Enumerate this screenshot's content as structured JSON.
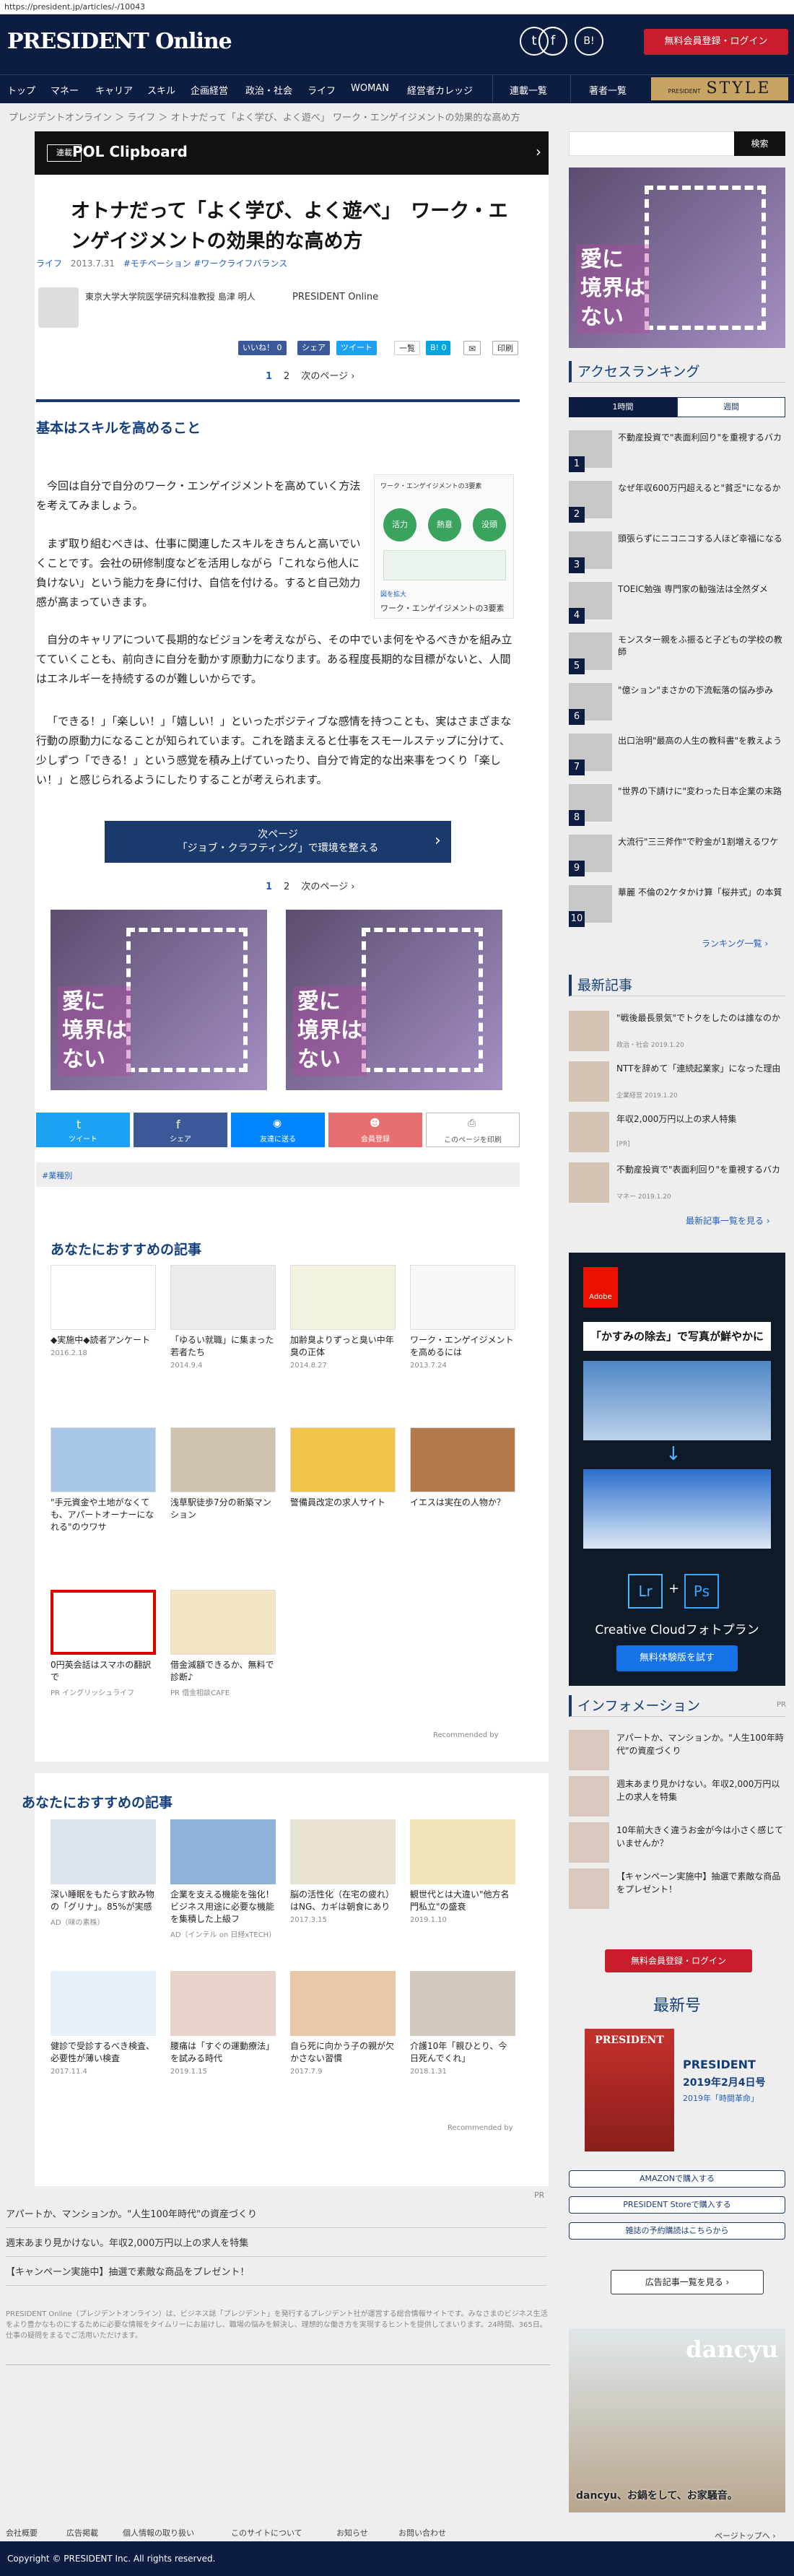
{
  "url": "https://president.jp/articles/-/10043",
  "brand": {
    "logo": "PRESIDENT Online",
    "register": "無料会員登録・ログイン",
    "style_logo": "STYLE",
    "style_prefix": "PRESIDENT"
  },
  "social": {
    "twitter": "t",
    "facebook": "f",
    "hatena": "B!"
  },
  "nav": [
    "トップ",
    "マネー",
    "キャリア",
    "スキル",
    "企画経営",
    "政治・社会",
    "ライフ",
    "WOMAN",
    "経営者カレッジ",
    "連載一覧",
    "著者一覧"
  ],
  "breadcrumb": "プレジデントオンライン ＞ ライフ ＞ オトナだって「よく学び、よく遊べ」 ワーク・エンゲイジメントの効果的な高め方",
  "series": {
    "badge": "連載",
    "title": "POL Clipboard"
  },
  "article": {
    "title": "オトナだって「よく学び、よく遊べ」　ワーク・エンゲイジメントの効果的な高め方",
    "category": "ライフ",
    "date": "2013.7.31",
    "tags": "#モチベーション  #ワークライフバランス",
    "author": "東京大学大学院医学研究科准教授 島津 明人",
    "source": "PRESIDENT Online",
    "share": {
      "like": "いいね！ 0",
      "share": "シェア",
      "tweet": "ツイート",
      "plusone": "一覧",
      "bookmark": "B! 0",
      "print": "印刷"
    },
    "pager": {
      "p1": "1",
      "p2": "2",
      "next": "次のページ ›"
    },
    "section_title": "基本はスキルを高めること",
    "p1": "今回は自分で自分のワーク・エンゲイジメントを高めていく方法を考えてみましょう。",
    "p2": "まず取り組むべきは、仕事に関連したスキルをきちんと高いでいくことです。会社の研修制度などを活用しながら「これなら他人に負けない」という能力を身に付け、自信を付ける。すると自己効力感が高まっていきます。",
    "p3": "自分のキャリアについて長期的なビジョンを考えながら、その中でいま何をやるべきかを組み立てていくことも、前向きに自分を動かす原動力になります。ある程度長期的な目標がないと、人間はエネルギーを持続するのが難しいからです。",
    "p4": "「できる！」「楽しい！」「嬉しい！」といったポジティブな感情を持つことも、実はさまざまな行動の原動力になることが知られています。これを踏まえると仕事をスモールステップに分けて、少しずつ「できる！」という感覚を積み上げていったり、自分で肯定的な出来事をつくり「楽しい！」と感じられるようにしたりすることが考えられます。",
    "figure_title": "ワーク・エンゲイジメントの3要素",
    "figure_caption": "ワーク・エンゲイジメントの3要素",
    "figure_source": "図を拡大",
    "figure_items": [
      "活力",
      "熱意",
      "没頭"
    ],
    "next_btn_1": "次ページ",
    "next_btn_2": "「ジョブ・クラフティング」で環境を整える"
  },
  "ad_text": "愛に\n境界は\nない",
  "share_big": [
    "ツイート",
    "シェア",
    "友達に送る",
    "会員登録",
    "このページを印刷"
  ],
  "tag": "#業種別",
  "rec1": {
    "title": "あなたにおすすめの記事",
    "items": [
      {
        "title": "◆実施中◆読者アンケート",
        "date": "2016.2.18"
      },
      {
        "title": "「ゆるい就職」に集まった若者たち",
        "date": "2014.9.4"
      },
      {
        "title": "加齢臭よりずっと臭い中年臭の正体",
        "date": "2014.8.27"
      },
      {
        "title": "ワーク・エンゲイジメントを高めるには",
        "date": "2013.7.24"
      },
      {
        "title": "\"手元資金や土地がなくても、アパートオーナーになれる\"のウワサ",
        "date": ""
      },
      {
        "title": "浅草駅徒歩7分の新築マンション",
        "date": ""
      },
      {
        "title": "警備員改定の求人サイト",
        "date": ""
      },
      {
        "title": "イエスは実在の人物か？",
        "date": ""
      },
      {
        "title": "0円英会話はスマホの翻訳で",
        "date": "PR イングリッシュライフ"
      },
      {
        "title": "借金減額できるか、無料で診断♪",
        "date": "PR 借金相談CAFE"
      }
    ],
    "recommended": "Recommended by"
  },
  "rec2": {
    "title": "あなたにおすすめの記事",
    "items": [
      {
        "title": "深い睡眠をもたらす飲み物の「グリナ」。85%が実感",
        "date": "AD（味の素株）"
      },
      {
        "title": "企業を支える機能を強化！ビジネス用途に必要な機能を集積した上級フ",
        "date": "AD（インテル on 日経xTECH）"
      },
      {
        "title": "脳の活性化（在宅の疲れ）はNG、カギは朝食にあり",
        "date": "2017.3.15"
      },
      {
        "title": "観世代とは大違い\"他方名門私立\"の盛衰",
        "date": "2019.1.10"
      },
      {
        "title": "健診で受診するべき検査、必要性が薄い検査",
        "date": "2017.11.4"
      },
      {
        "title": "腰痛は「すぐの運動療法」を試みる時代",
        "date": "2019.1.15"
      },
      {
        "title": "自ら死に向かう子の親が欠かさない習慣",
        "date": "2017.7.9"
      },
      {
        "title": "介護10年「親ひとり、今日死んでくれ」",
        "date": "2018.1.31"
      }
    ],
    "recommended": "Recommended by"
  },
  "sidebar": {
    "search_btn": "検索",
    "ranking_title": "アクセスランキング",
    "tab1": "1時間",
    "tab2": "週間",
    "ranking": [
      "不動産投資で\"表面利回り\"を重視するバカ",
      "なぜ年収600万円超えると\"貧乏\"になるか",
      "頭張らずにニコニコする人ほど幸福になる",
      "TOEIC勉強 専門家の勧強法は全然ダメ",
      "モンスター親をふ振ると子どもの学校の教師",
      "\"億ション\"まさかの下流転落の悩み歩み",
      "出口治明\"最高の人生の教科書\"を教えよう",
      "\"世界の下請けに\"変わった日本企業の末路",
      "大流行\"三三斧作\"で貯金が1割増えるワケ",
      "華麗 不倫の2ケタかけ算「桜井式」の本質"
    ],
    "ranking_more": "ランキング一覧 ›",
    "news_title": "最新記事",
    "news": [
      {
        "title": "\"戦後最長景気\"でトクをしたのは誰なのか",
        "date": "政治・社会 2019.1.20"
      },
      {
        "title": "NTTを辞めて「連続起業家」になった理由",
        "date": "企業経営 2019.1.20"
      },
      {
        "title": "年収2,000万円以上の求人特集",
        "date": "[PR]"
      },
      {
        "title": "不動産投資で\"表面利回り\"を重視するバカ",
        "date": "マネー 2019.1.20"
      }
    ],
    "news_more": "最新記事一覧を見る ›",
    "adobe": {
      "brand": "Adobe",
      "headline": "「かすみの除去」で写真が鮮やかに",
      "lr": "Lr",
      "ps": "Ps",
      "plan": "Creative Cloudフォトプラン",
      "cta": "無料体験版を試す"
    },
    "info_title": "インフォメーション",
    "pr": "PR",
    "info": [
      "アパートか、マンションか。\"人生100年時代\"の資産づくり",
      "週末あまり見かけない。年収2,000万円以上の求人を特集",
      "10年前大きく違うお金が今は小さく感じていませんか？",
      "【キャンペーン実施中】抽選で素敵な商品をプレゼント！"
    ],
    "register": "無料会員登録・ログイン",
    "issue_title": "最新号",
    "magazine": "PRESIDENT",
    "issue_date": "2019年2月4日号",
    "issue_sub": "2019年「時間革命」",
    "btns": [
      "AMAZONで購入する",
      "PRESIDENT Storeで購入する",
      "雑誌の予約購読はこちらから"
    ],
    "ad_list": "広告記事一覧を見る ›",
    "dancyu_logo": "dancyu",
    "dancyu_sub": "dancyu、お鍋をして、お家騒音。"
  },
  "bottom_pr": "PR",
  "bottom_links": [
    "アパートか、マンションか。\"人生100年時代\"の資産づくり",
    "週末あまり見かけない。年収2,000万円以上の求人を特集",
    "【キャンペーン実施中】抽選で素敵な商品をプレゼント！"
  ],
  "disclaimer": "PRESIDENT Online（プレジデントオンライン）は、ビジネス誌「プレジデント」を発行するプレジデント社が運営する総合情報サイトです。みなさまのビジネス生活をより豊かなものにするために必要な情報をタイムリーにお届けし、職場の悩みを解決し、理想的な働き方を実現するヒントを提供してまいります。24時間、365日。仕事の疑問をまるでご活用いただけます。",
  "footer_links": [
    "会社概要",
    "広告掲載",
    "個人情報の取り扱い",
    "このサイトについて",
    "お知らせ",
    "お問い合わせ"
  ],
  "page_top": "ページトップへ ›",
  "copyright": "Copyright © PRESIDENT Inc. All rights reserved."
}
